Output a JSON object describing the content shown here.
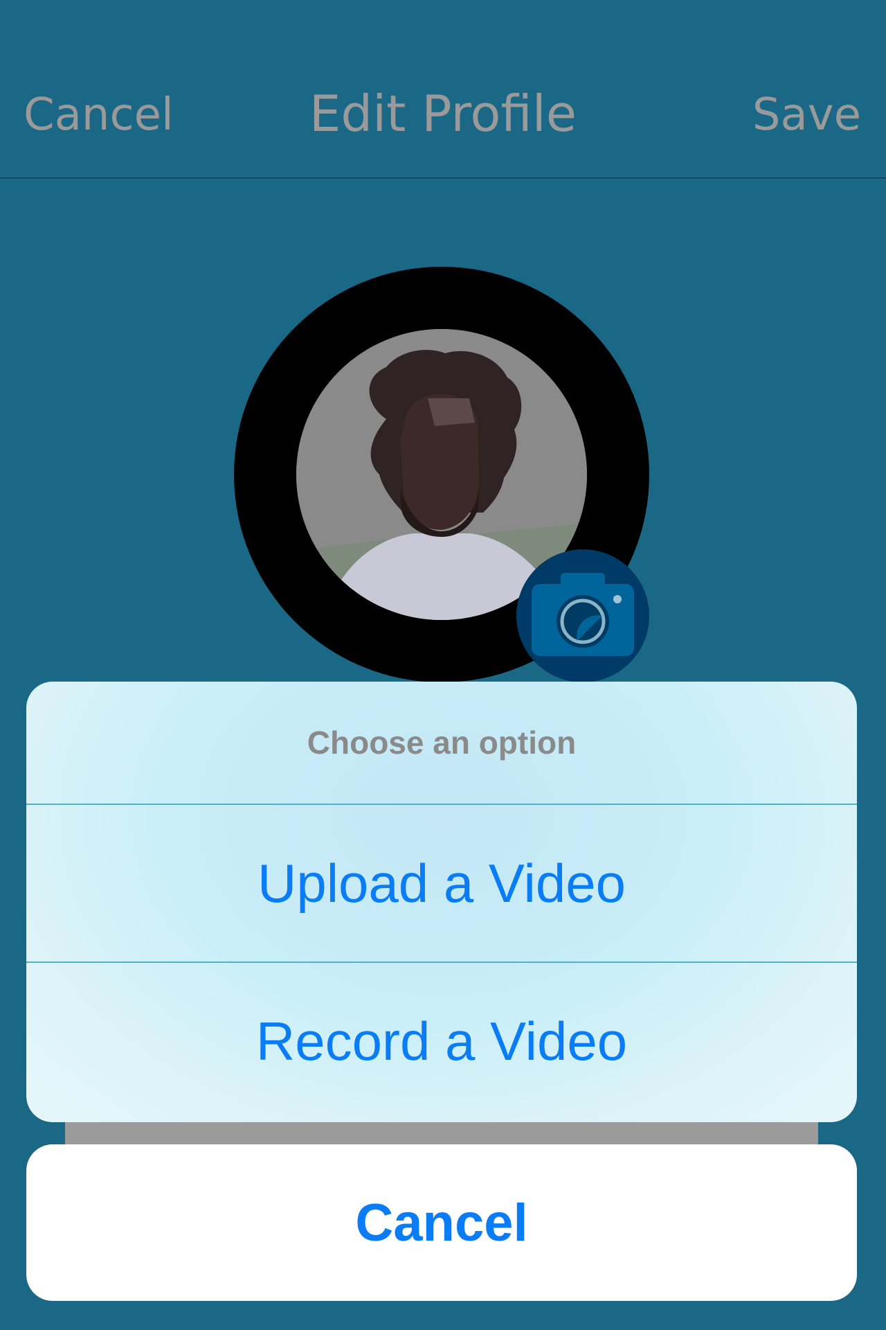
{
  "nav": {
    "left_label": "Cancel",
    "title": "Edit Profile",
    "right_label": "Save"
  },
  "avatar": {
    "icon": "camera-icon"
  },
  "action_sheet": {
    "title": "Choose an option",
    "options": [
      {
        "label": "Upload a Video"
      },
      {
        "label": "Record a Video"
      }
    ],
    "cancel_label": "Cancel"
  },
  "colors": {
    "background": "#1a6885",
    "nav_text": "#9a9a9a",
    "accent_blue": "#0a7cf5",
    "camera_badge": "#003a66"
  }
}
